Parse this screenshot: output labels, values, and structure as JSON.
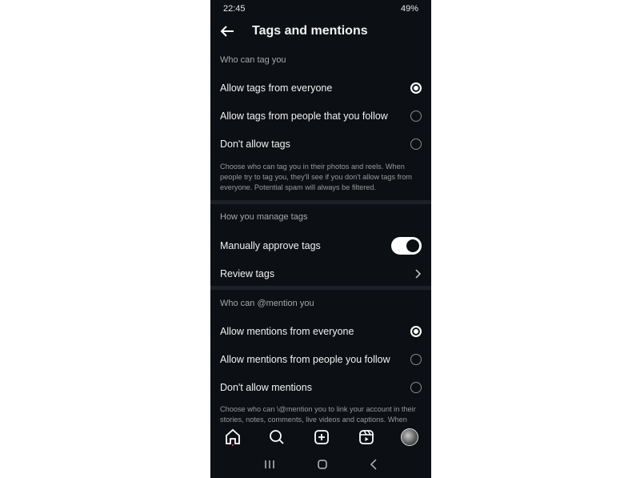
{
  "status_bar": {
    "time": "22:45",
    "battery": "49%"
  },
  "header": {
    "title": "Tags and mentions",
    "back_icon": "arrow-left-icon"
  },
  "tags": {
    "section_label": "Who can tag you",
    "options": [
      {
        "label": "Allow tags from everyone",
        "selected": true
      },
      {
        "label": "Allow tags from people that you follow",
        "selected": false
      },
      {
        "label": "Don't allow tags",
        "selected": false
      }
    ],
    "description": "Choose who can tag you in their photos and reels. When people try to tag you, they'll see if you don't allow tags from everyone. Potential spam will always be filtered."
  },
  "manage": {
    "section_label": "How you manage tags",
    "manual_approve_label": "Manually approve tags",
    "manual_approve_on": true,
    "review_label": "Review tags"
  },
  "mentions": {
    "section_label": "Who can @mention you",
    "options": [
      {
        "label": "Allow mentions from everyone",
        "selected": true
      },
      {
        "label": "Allow mentions from people you follow",
        "selected": false
      },
      {
        "label": "Don't allow mentions",
        "selected": false
      }
    ],
    "description": "Choose who can \\@mention you to link your account in their stories, notes, comments, live videos and captions. When"
  },
  "bottom_nav": [
    "home-icon",
    "search-icon",
    "create-icon",
    "reels-icon",
    "profile-avatar"
  ],
  "colors": {
    "background": "#0c0f14",
    "divider": "#1d2026",
    "text": "#f2f2f2",
    "secondary": "#a8a8a8",
    "notification_dot": "#e0245e"
  }
}
